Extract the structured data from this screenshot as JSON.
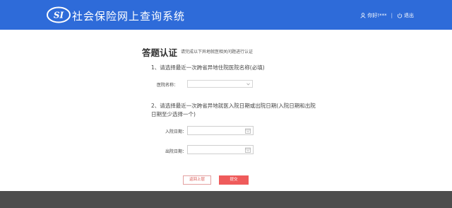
{
  "header": {
    "title": "社会保险网上查询系统",
    "user_name": "你好!",
    "user_id": "*** ",
    "logout_label": "退出"
  },
  "main": {
    "title": "答题认证",
    "subtitle": "请完成以下异地就医相关问题进行认证",
    "question1": "1、请选择最近一次跨省异地住院医院名称(必填)",
    "hospital_label": "医院名称：",
    "hospital_value": "",
    "question2": "2、请选择最近一次跨省异地就医入院日期或出院日期(入院日期和出院日期至少选择一个)",
    "admission_label": "入院日期：",
    "discharge_label": "出院日期："
  },
  "buttons": {
    "back": "返回上层",
    "submit": "提交"
  },
  "colors": {
    "header_bg": "#2e6bd9",
    "submit_bg": "#ef5b5b",
    "footer_bg": "#4d4d4d"
  }
}
